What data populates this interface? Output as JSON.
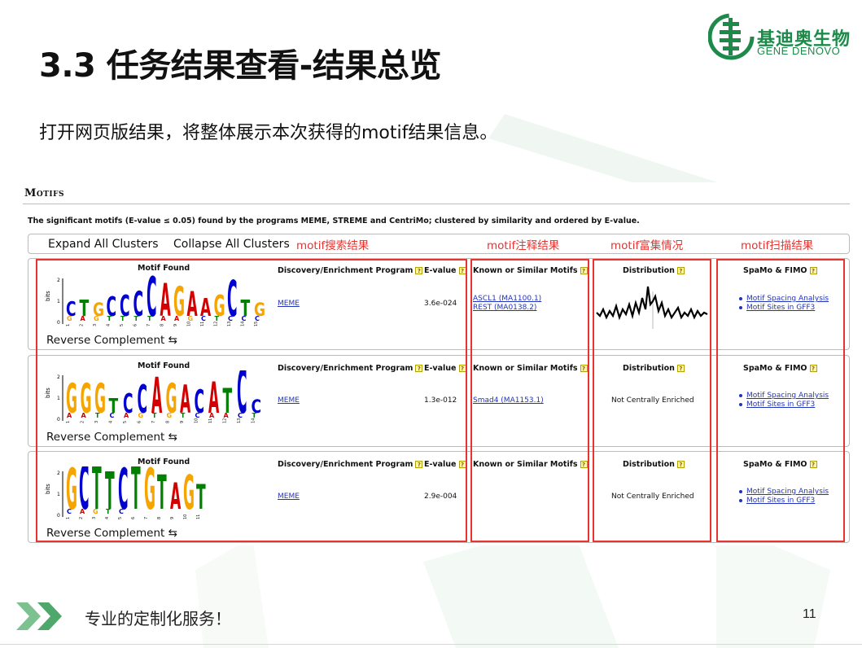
{
  "slide": {
    "title": "3.3 任务结果查看-结果总览",
    "subtitle": "打开网页版结果，将整体展示本次获得的motif结果信息。",
    "footer": "专业的定制化服务！",
    "page_number": "11"
  },
  "logo": {
    "cn": "基迪奥生物",
    "en": "GENE DENOVO",
    "color": "#1d8a4a"
  },
  "report": {
    "section_title": "Motifs",
    "summary": "The significant motifs (E-value ≤ 0.05) found by the programs MEME, STREME and CentriMo; clustered by similarity and ordered by E-value.",
    "expand_all": "Expand All Clusters",
    "collapse_all": "Collapse All Clusters",
    "annotations": [
      "motif搜索结果",
      "motif注释结果",
      "motif富集情况",
      "motif扫描结果"
    ],
    "headers": {
      "motif_found": "Motif Found",
      "program": "Discovery/Enrichment Program",
      "evalue": "E-value",
      "known": "Known or Similar Motifs",
      "distribution": "Distribution",
      "spamo": "SpaMo & FIMO"
    },
    "help_glyph": "?",
    "bits_label": "bits",
    "reverse_complement": "Reverse Complement ⇆",
    "spacing_link": "Motif Spacing Analysis",
    "sites_link": "Motif Sites in GFF3",
    "motifs": [
      {
        "program": "MEME",
        "evalue": "3.6e-024",
        "known": [
          "ASCL1 (MA1100.1)",
          "REST (MA0138.2)"
        ],
        "distribution": "",
        "logo_top": "CTGCCCCAGAAGCTG",
        "logo_bottom": "GAGTTTTAAGCTCCCX",
        "positions": [
          "1",
          "2",
          "3",
          "4",
          "5",
          "6",
          "7",
          "8",
          "9",
          "10",
          "11",
          "12",
          "13",
          "14",
          "15"
        ]
      },
      {
        "program": "MEME",
        "evalue": "1.3e-012",
        "known": [
          "Smad4 (MA1153.1)"
        ],
        "distribution": "Not Centrally Enriched",
        "logo_top": "GGGTCCAGACATCC",
        "logo_bottom": "AATCAGTGTCAACT",
        "positions": [
          "1",
          "2",
          "3",
          "4",
          "5",
          "6",
          "7",
          "8",
          "9",
          "10",
          "11",
          "12",
          "13",
          "14",
          "15"
        ]
      },
      {
        "program": "MEME",
        "evalue": "2.9e-004",
        "known": [],
        "distribution": "Not Centrally Enriched",
        "logo_top": "GCTTCTGTAGT",
        "logo_bottom": "CAGTC",
        "positions": [
          "1",
          "2",
          "3",
          "4",
          "5",
          "6",
          "7",
          "8",
          "9",
          "10",
          "11"
        ]
      }
    ]
  },
  "colors": {
    "red_annotation": "#e8332e",
    "link": "#2233bb",
    "A": "#d40000",
    "C": "#0000d0",
    "G": "#f5a400",
    "T": "#008000"
  }
}
